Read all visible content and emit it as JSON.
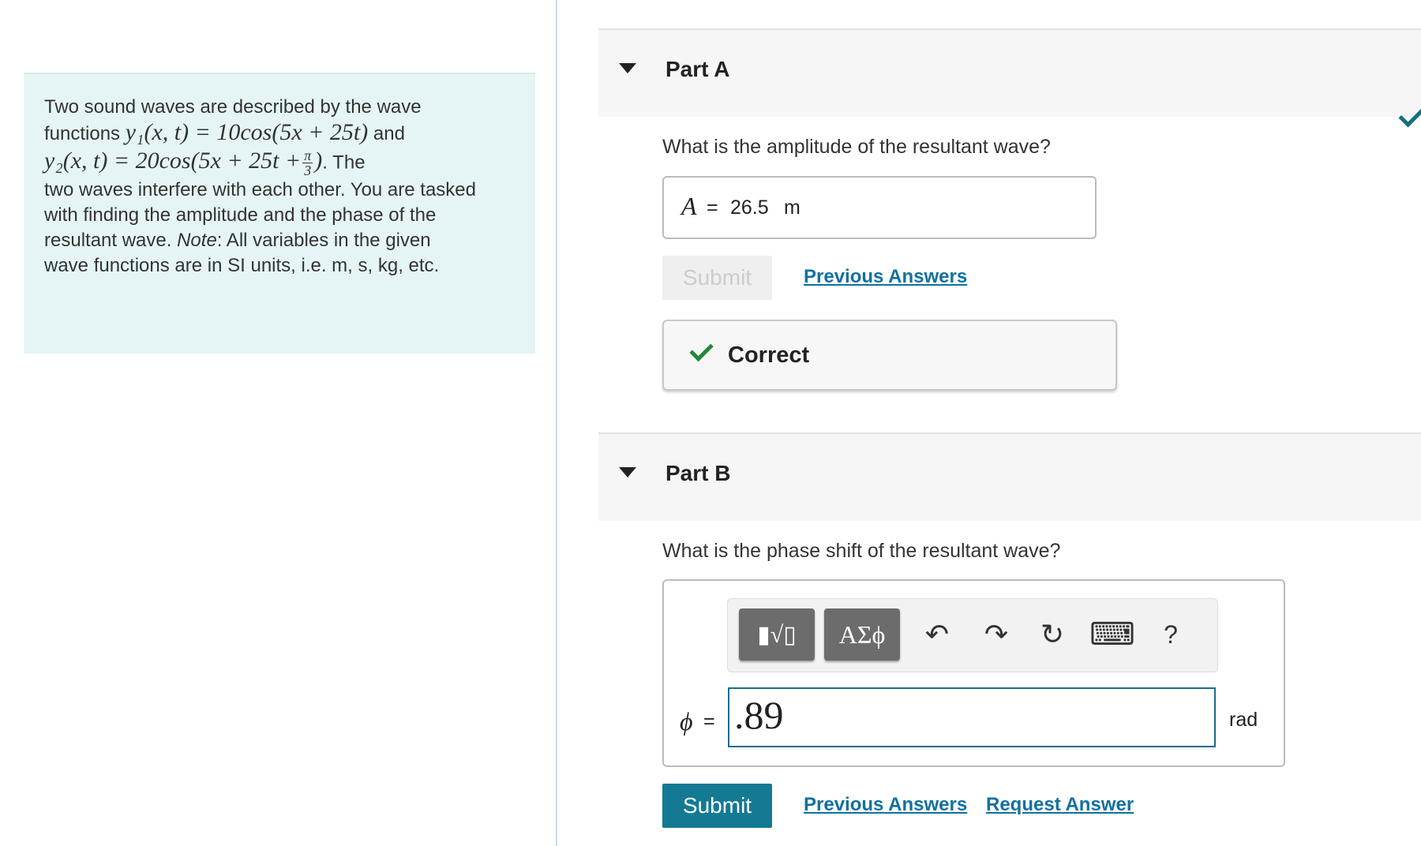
{
  "problem": {
    "line1": "Two sound waves are described by the wave",
    "line2_prefix": "functions",
    "eq1": "y₁(x, t) = 10cos(5x + 25t)",
    "line2_suffix": "and",
    "eq2_prefix": "y₂(x, t) = 20cos(5x + 25t +",
    "frac_num": "π",
    "frac_den": "3",
    "eq2_suffix": ")",
    "line3_suffix": ". The",
    "line4": "two waves interfere with each other. You are tasked",
    "line5": "with finding the amplitude and the phase of the",
    "line6_prefix": "resultant wave.",
    "line6_note": "Note",
    "line6_suffix": ": All variables in the given",
    "line7": "wave functions are in SI units, i.e. m, s, kg, etc."
  },
  "part_a": {
    "title": "Part A",
    "question": "What is the amplitude of the resultant wave?",
    "symbol": "A",
    "equals": "=",
    "value": "26.5",
    "unit": "m",
    "submit_label": "Submit",
    "previous_answers": "Previous Answers",
    "feedback": "Correct"
  },
  "part_b": {
    "title": "Part B",
    "question": "What is the phase shift of the resultant wave?",
    "toolbar": {
      "templates_label": "▮√▯",
      "greek_label": "ΑΣϕ",
      "undo": "↶",
      "redo": "↷",
      "reset": "↻",
      "keyboard": "⌨",
      "help": "?"
    },
    "symbol": "ϕ",
    "equals": "=",
    "value": ".89",
    "unit": "rad",
    "submit_label": "Submit",
    "previous_answers": "Previous Answers",
    "request_answer": "Request Answer"
  },
  "colors": {
    "accent": "#147a94",
    "link": "#1071a0",
    "correct": "#22893a",
    "panel_bg": "#e5f5f5"
  }
}
